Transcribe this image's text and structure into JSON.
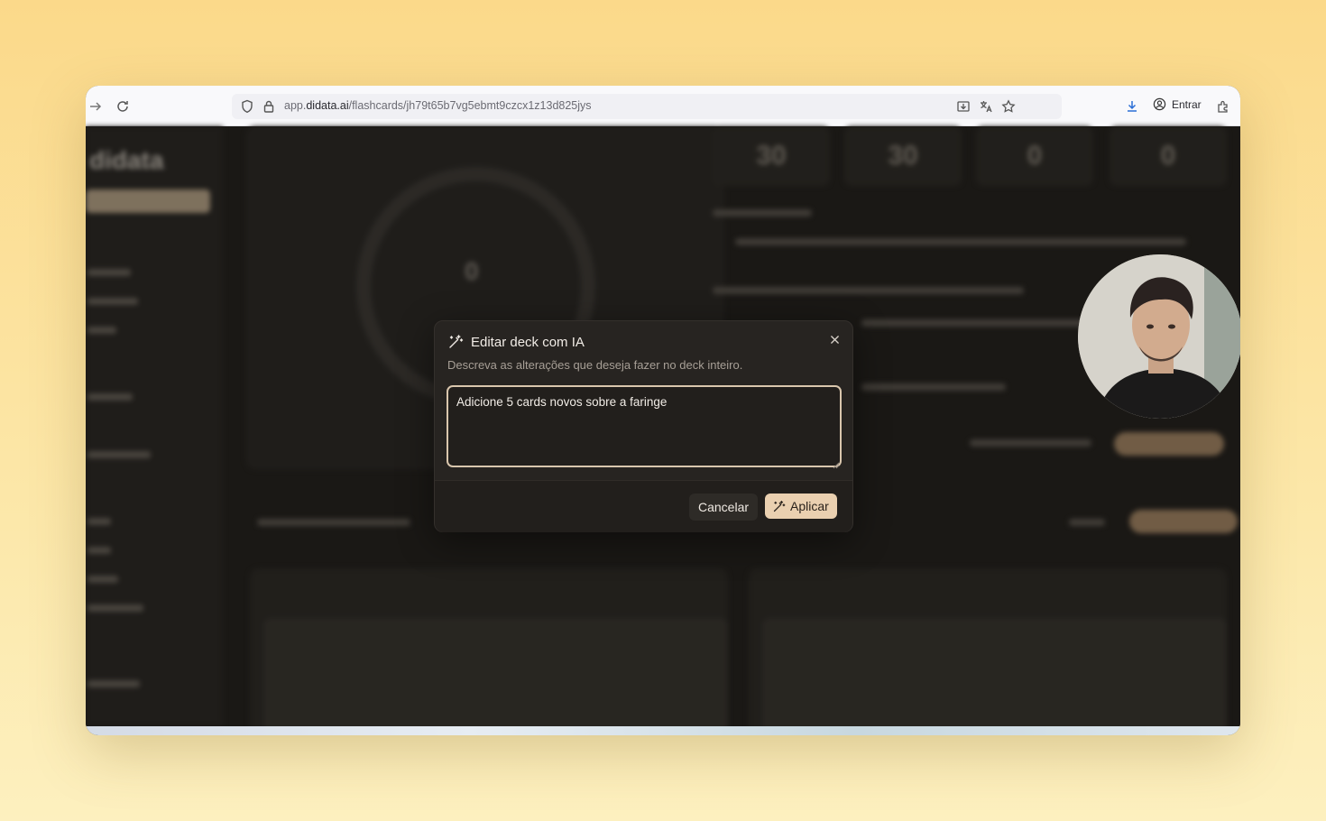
{
  "browser": {
    "url_prefix": "app.",
    "url_domain": "didata.ai",
    "url_path": "/flashcards/jh79t65b7vg5ebmt9czcx1z13d825jys",
    "signin_label": "Entrar"
  },
  "background_app": {
    "logo": "didata",
    "stats": [
      "30",
      "30",
      "0",
      "0"
    ],
    "progress_value": "0"
  },
  "dialog": {
    "title": "Editar deck com IA",
    "description": "Descreva as alterações que deseja fazer no deck inteiro.",
    "textarea_value": "Adicione 5 cards novos sobre a faringe",
    "cancel_label": "Cancelar",
    "apply_label": "Aplicar"
  },
  "colors": {
    "accent": "#ead0b0",
    "dialog_bg": "#272421",
    "focus_border": "#d9c6ad"
  }
}
